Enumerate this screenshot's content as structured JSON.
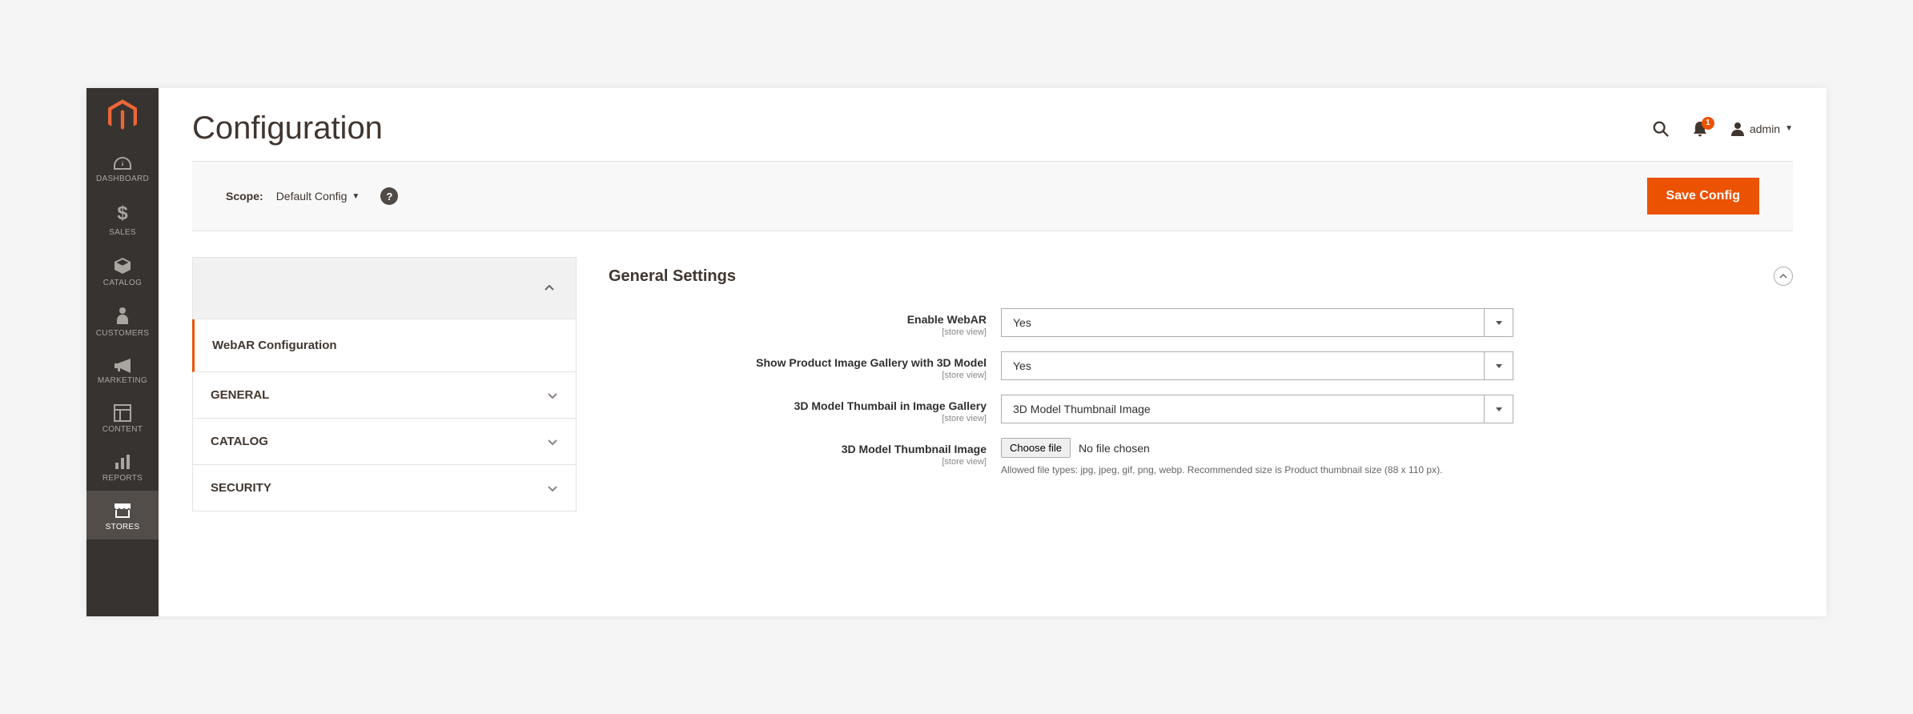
{
  "sidebar": {
    "items": [
      {
        "label": "DASHBOARD"
      },
      {
        "label": "SALES"
      },
      {
        "label": "CATALOG"
      },
      {
        "label": "CUSTOMERS"
      },
      {
        "label": "MARKETING"
      },
      {
        "label": "CONTENT"
      },
      {
        "label": "REPORTS"
      },
      {
        "label": "STORES"
      }
    ]
  },
  "header": {
    "title": "Configuration",
    "notif_count": "1",
    "user_label": "admin"
  },
  "scope": {
    "label": "Scope:",
    "value": "Default Config",
    "save_button": "Save Config"
  },
  "config_nav": {
    "active": "WebAR Configuration",
    "items": [
      {
        "label": "GENERAL"
      },
      {
        "label": "CATALOG"
      },
      {
        "label": "SECURITY"
      }
    ]
  },
  "settings": {
    "title": "General Settings",
    "scope_hint": "[store view]",
    "fields": {
      "enable": {
        "label": "Enable WebAR",
        "value": "Yes"
      },
      "gallery": {
        "label": "Show Product Image Gallery with 3D Model",
        "value": "Yes"
      },
      "thumb_mode": {
        "label": "3D Model Thumbail in Image Gallery",
        "value": "3D Model Thumbnail Image"
      },
      "thumb_image": {
        "label": "3D Model Thumbnail Image",
        "button": "Choose file",
        "status": "No file chosen",
        "hint": "Allowed file types: jpg, jpeg, gif, png, webp. Recommended size is Product thumbnail size (88 x 110 px)."
      }
    }
  }
}
